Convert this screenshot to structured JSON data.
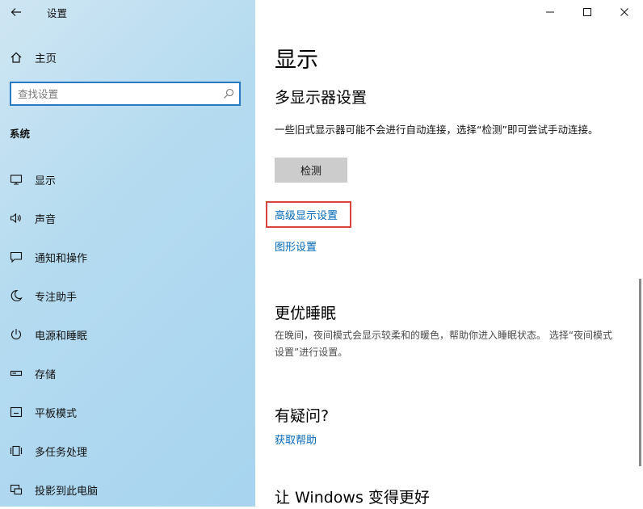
{
  "window": {
    "title": "设置"
  },
  "sidebar": {
    "home_label": "主页",
    "search_placeholder": "查找设置",
    "section_title": "系统",
    "items": [
      {
        "label": "显示",
        "icon": "monitor-icon"
      },
      {
        "label": "声音",
        "icon": "speaker-icon"
      },
      {
        "label": "通知和操作",
        "icon": "notification-icon"
      },
      {
        "label": "专注助手",
        "icon": "moon-icon"
      },
      {
        "label": "电源和睡眠",
        "icon": "power-icon"
      },
      {
        "label": "存储",
        "icon": "storage-icon"
      },
      {
        "label": "平板模式",
        "icon": "tablet-icon"
      },
      {
        "label": "多任务处理",
        "icon": "multitask-icon"
      },
      {
        "label": "投影到此电脑",
        "icon": "project-icon"
      }
    ]
  },
  "main": {
    "page_title": "显示",
    "multi_display": {
      "heading": "多显示器设置",
      "description": "一些旧式显示器可能不会进行自动连接，选择“检测”即可尝试手动连接。",
      "detect_button": "检测",
      "advanced_link": "高级显示设置",
      "graphics_link": "图形设置"
    },
    "sleep": {
      "heading": "更优睡眠",
      "description": "在晚间，夜间模式会显示较柔和的暖色，帮助你进入睡眠状态。 选择“夜间模式设置”进行设置。"
    },
    "questions": {
      "heading": "有疑问?",
      "help_link": "获取帮助"
    },
    "improve": {
      "heading": "让 Windows 变得更好"
    }
  },
  "colors": {
    "accent": "#0067b8",
    "highlight_border": "#d9443b",
    "sidebar_bg": "#b5dbf0"
  }
}
